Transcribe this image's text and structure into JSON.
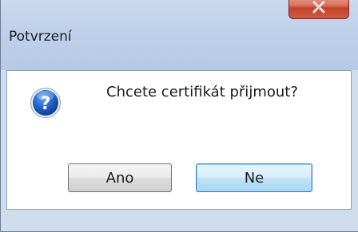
{
  "dialog": {
    "title": "Potvrzení",
    "message": "Chcete certifikát přijmout?",
    "icon": "question-icon",
    "buttons": {
      "yes_label": "Ano",
      "no_label": "Ne"
    }
  },
  "colors": {
    "close_button": "#c4432b",
    "titlebar": "#bfd1ea",
    "default_button_border": "#3c7fb1"
  }
}
